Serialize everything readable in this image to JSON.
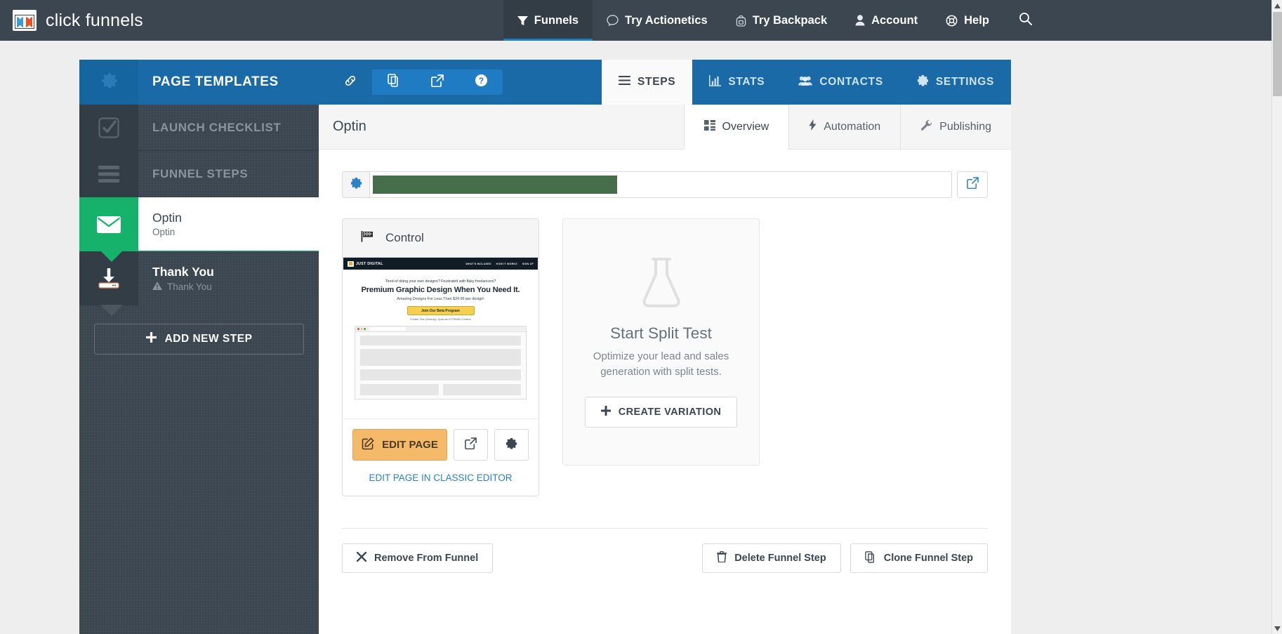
{
  "topnav": {
    "brand": "click funnels",
    "items": [
      {
        "label": "Funnels",
        "icon": "funnel-icon",
        "active": true
      },
      {
        "label": "Try Actionetics",
        "icon": "chat-icon",
        "active": false
      },
      {
        "label": "Try Backpack",
        "icon": "backpack-icon",
        "active": false
      },
      {
        "label": "Account",
        "icon": "user-icon",
        "active": false
      },
      {
        "label": "Help",
        "icon": "lifering-icon",
        "active": false
      }
    ],
    "search_icon": "search-icon"
  },
  "header": {
    "gear_icon": "gear-icon",
    "title": "PAGE TEMPLATES",
    "icon_buttons": [
      {
        "name": "link-icon",
        "selected": true
      },
      {
        "name": "clone-icon",
        "selected": false
      },
      {
        "name": "external-link-icon",
        "selected": false
      },
      {
        "name": "help-circle-icon",
        "selected": false
      }
    ],
    "tabs": [
      {
        "label": "STEPS",
        "icon": "list-icon",
        "active": true
      },
      {
        "label": "STATS",
        "icon": "chart-icon",
        "active": false
      },
      {
        "label": "CONTACTS",
        "icon": "people-icon",
        "active": false
      },
      {
        "label": "SETTINGS",
        "icon": "gear-icon",
        "active": false
      }
    ]
  },
  "sidebar": {
    "sections": [
      {
        "label": "LAUNCH CHECKLIST",
        "icon": "checkbox-icon"
      },
      {
        "label": "FUNNEL STEPS",
        "icon": "hamburger-icon"
      }
    ],
    "steps": [
      {
        "name": "Optin",
        "subtitle": "Optin",
        "icon": "envelope-icon",
        "active": true,
        "warning": false
      },
      {
        "name": "Thank You",
        "subtitle": "Thank You",
        "icon": "download-icon",
        "active": false,
        "warning": true
      }
    ],
    "add_step_label": "ADD NEW STEP",
    "add_step_icon": "plus-icon"
  },
  "content": {
    "step_title": "Optin",
    "subtabs": [
      {
        "label": "Overview",
        "icon": "grid-icon",
        "active": true
      },
      {
        "label": "Automation",
        "icon": "bolt-icon",
        "active": false
      },
      {
        "label": "Publishing",
        "icon": "wrench-icon",
        "active": false
      }
    ],
    "url_row": {
      "gear_icon": "gear-icon",
      "value": "",
      "placeholder": "",
      "redacted": true,
      "open_icon": "external-link-icon"
    },
    "control_card": {
      "flag_icon": "flag-icon",
      "title": "Control",
      "edit_label": "EDIT PAGE",
      "edit_icon": "pencil-square-icon",
      "preview_icon": "external-link-icon",
      "settings_icon": "gear-icon",
      "classic_link": "EDIT PAGE IN CLASSIC EDITOR",
      "preview": {
        "brand": "JUST DIGITAL",
        "nav_links": [
          "WHAT'S INCLUDED",
          "HOW IT WORKS",
          "SIGN UP"
        ],
        "kicker": "Tired of doing your own designs? Frustrated with flaky freelancers?",
        "headline": "Premium Graphic Design When You Need It.",
        "subhead": "Amazing Designs For Less Than $24.99 per design!",
        "cta": "Join Our Beta Program",
        "fine_print": "*Limited Time (Seriously). Spots are EXTREMELY limited!"
      }
    },
    "split_card": {
      "flask_icon": "flask-icon",
      "title": "Start Split Test",
      "description": "Optimize your lead and sales generation with split tests.",
      "button_label": "CREATE VARIATION",
      "button_icon": "plus-icon"
    },
    "bottom_buttons": [
      {
        "label": "Remove From Funnel",
        "icon": "x-icon",
        "align": "left"
      },
      {
        "label": "Delete Funnel Step",
        "icon": "trash-icon",
        "align": "right"
      },
      {
        "label": "Clone Funnel Step",
        "icon": "clone-icon",
        "align": "right"
      }
    ]
  },
  "colors": {
    "nav_bg": "#3b4650",
    "header_blue": "#1a6aa8",
    "accent_green": "#16b26c",
    "edit_orange": "#f5b96a",
    "link_blue": "#2b82c9",
    "redact_green": "#476e4b"
  }
}
